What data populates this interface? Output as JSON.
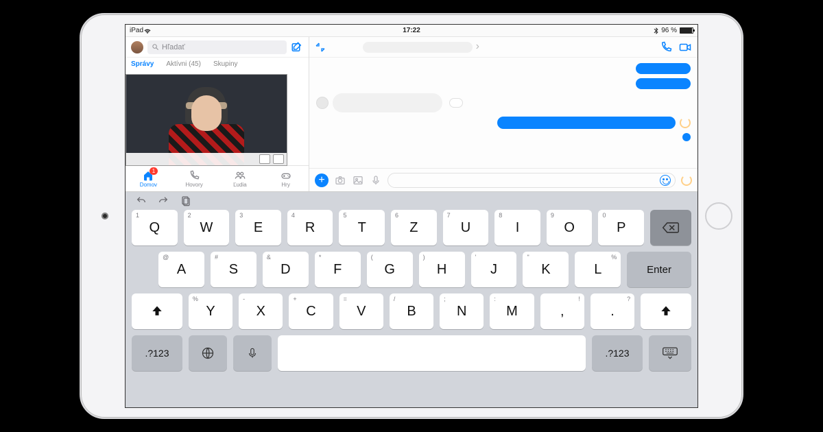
{
  "status": {
    "carrier": "iPad",
    "time": "17:22",
    "battery_pct": "96 %"
  },
  "search": {
    "placeholder": "Hľadať"
  },
  "sidebar_tabs": {
    "messages": "Správy",
    "active": "Aktívni (45)",
    "groups": "Skupiny"
  },
  "tabbar": {
    "home": "Domov",
    "home_badge": "1",
    "calls": "Hovory",
    "people": "Ľudia",
    "games": "Hry"
  },
  "keyboard": {
    "enter": "Enter",
    "symbols": ".?123",
    "row1": [
      {
        "main": "Q",
        "altL": "1"
      },
      {
        "main": "W",
        "altL": "2"
      },
      {
        "main": "E",
        "altL": "3"
      },
      {
        "main": "R",
        "altL": "4"
      },
      {
        "main": "T",
        "altL": "5"
      },
      {
        "main": "Z",
        "altL": "6"
      },
      {
        "main": "U",
        "altL": "7"
      },
      {
        "main": "I",
        "altL": "8"
      },
      {
        "main": "O",
        "altL": "9"
      },
      {
        "main": "P",
        "altL": "0"
      }
    ],
    "row2": [
      {
        "main": "A",
        "altL": "@"
      },
      {
        "main": "S",
        "altL": "#"
      },
      {
        "main": "D",
        "altL": "&"
      },
      {
        "main": "F",
        "altL": "*"
      },
      {
        "main": "G",
        "altL": "("
      },
      {
        "main": "H",
        "altL": ")"
      },
      {
        "main": "J",
        "altL": "'"
      },
      {
        "main": "K",
        "altL": "\""
      },
      {
        "main": "L",
        "altR": "%"
      }
    ],
    "row3": [
      {
        "main": "Y",
        "altL": "%"
      },
      {
        "main": "X",
        "altL": "-"
      },
      {
        "main": "C",
        "altL": "+"
      },
      {
        "main": "V",
        "altL": "="
      },
      {
        "main": "B",
        "altL": "/"
      },
      {
        "main": "N",
        "altL": ";"
      },
      {
        "main": "M",
        "altL": ":"
      },
      {
        "main": ",",
        "altR": "!"
      },
      {
        "main": ".",
        "altR": "?"
      }
    ]
  }
}
